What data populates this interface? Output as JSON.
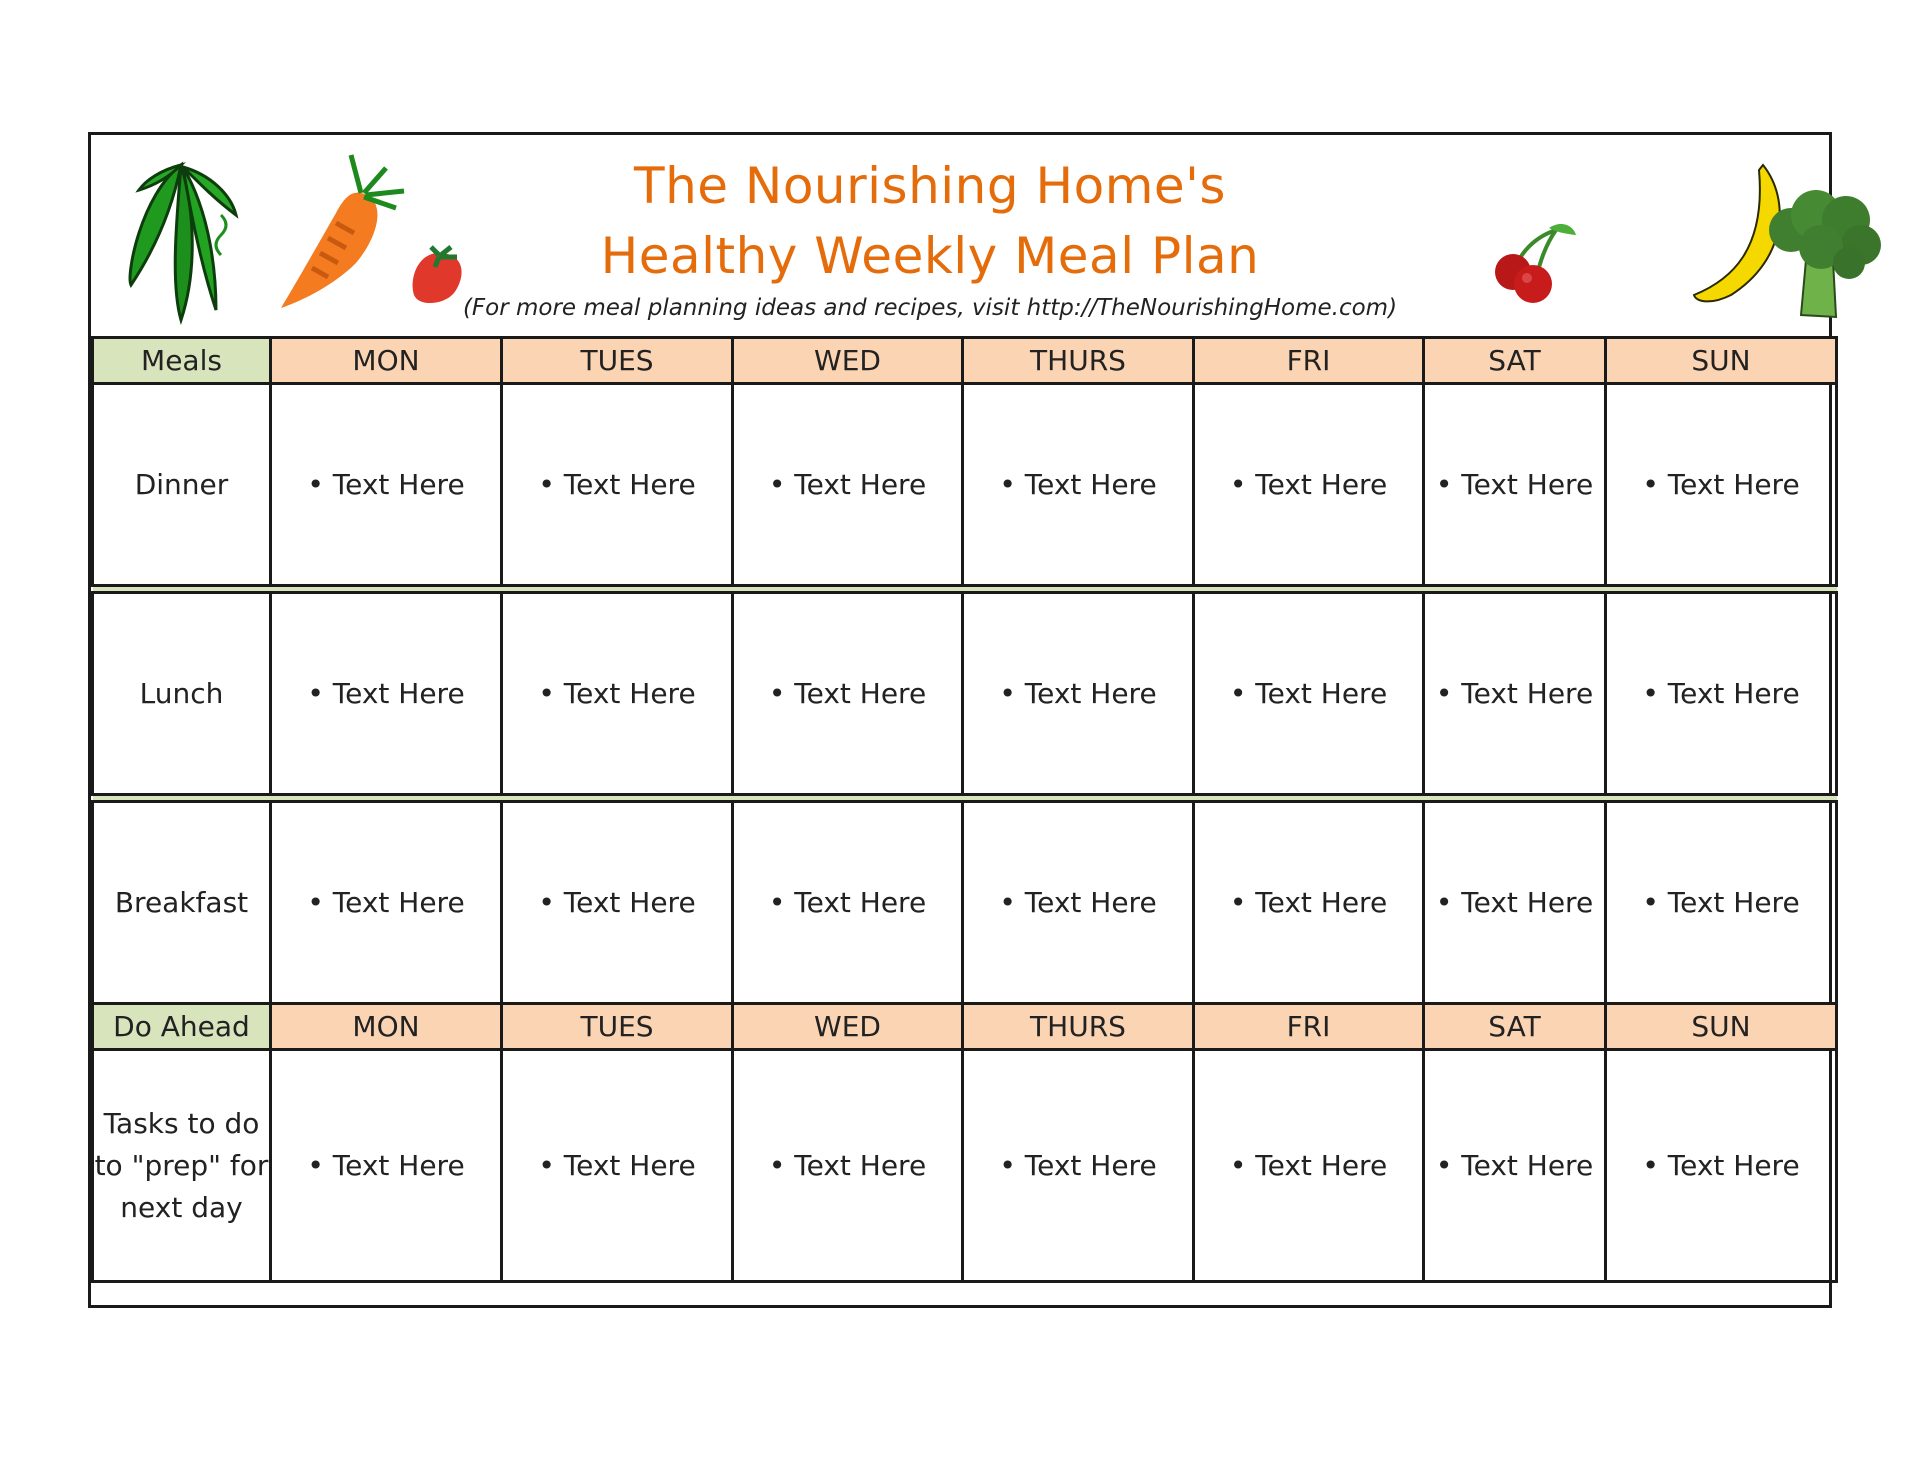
{
  "header": {
    "title_line1": "The Nourishing Home's",
    "title_line2": "Healthy Weekly Meal Plan",
    "subtitle": "(For more meal planning ideas and recipes, visit http://TheNourishingHome.com)",
    "images_left": [
      "peas-pod-icon",
      "carrot-icon",
      "strawberry-icon"
    ],
    "images_right": [
      "cherries-icon",
      "banana-icon",
      "broccoli-icon"
    ]
  },
  "colors": {
    "title": "#e46c0a",
    "day_header_bg": "#fbd4b4",
    "label_header_bg": "#d8e4bc",
    "separator": "#d8e4bc"
  },
  "table": {
    "meals_header": "Meals",
    "days": [
      "MON",
      "TUES",
      "WED",
      "THURS",
      "FRI",
      "SAT",
      "SUN"
    ],
    "rows": [
      {
        "label": "Dinner",
        "cells": [
          "Text Here",
          "Text Here",
          "Text Here",
          "Text Here",
          "Text Here",
          "Text Here",
          "Text Here"
        ]
      },
      {
        "label": "Lunch",
        "cells": [
          "Text Here",
          "Text Here",
          "Text Here",
          "Text Here",
          "Text Here",
          "Text Here",
          "Text Here"
        ]
      },
      {
        "label": "Breakfast",
        "cells": [
          "Text Here",
          "Text Here",
          "Text Here",
          "Text Here",
          "Text Here",
          "Text Here",
          "Text Here"
        ]
      }
    ],
    "do_ahead_header": "Do Ahead",
    "do_ahead_days": [
      "MON",
      "TUES",
      "WED",
      "THURS",
      "FRI",
      "SAT",
      "SUN"
    ],
    "do_ahead_label": "Tasks to do to \"prep\" for next day",
    "do_ahead_cells": [
      "Text Here",
      "Text Here",
      "Text Here",
      "Text Here",
      "Text Here",
      "Text Here",
      "Text Here"
    ]
  }
}
